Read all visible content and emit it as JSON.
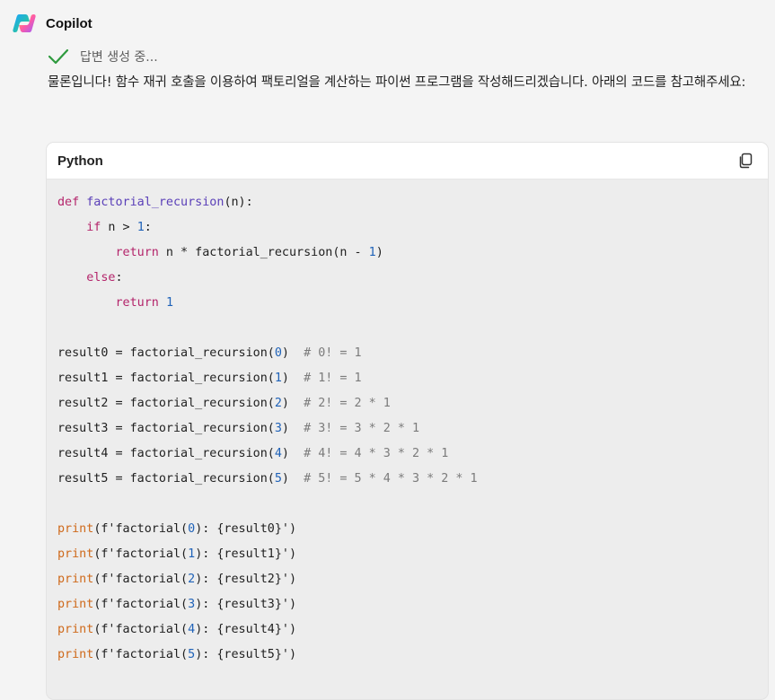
{
  "app": {
    "name": "Copilot",
    "logo_icon": "copilot-logo-icon"
  },
  "status": {
    "icon": "check-icon",
    "text": "답변 생성 중..."
  },
  "answer": {
    "text": "물론입니다! 함수 재귀 호출을 이용하여 팩토리얼을 계산하는 파이썬 프로그램을 작성해드리겠습니다. 아래의 코드를 참고해주세요:"
  },
  "code_block": {
    "language": "Python",
    "copy_icon": "copy-icon",
    "lines": [
      "def factorial_recursion(n):",
      "    if n > 1:",
      "        return n * factorial_recursion(n - 1)",
      "    else:",
      "        return 1",
      "",
      "result0 = factorial_recursion(0)  # 0! = 1",
      "result1 = factorial_recursion(1)  # 1! = 1",
      "result2 = factorial_recursion(2)  # 2! = 2 * 1",
      "result3 = factorial_recursion(3)  # 3! = 3 * 2 * 1",
      "result4 = factorial_recursion(4)  # 4! = 4 * 3 * 2 * 1",
      "result5 = factorial_recursion(5)  # 5! = 5 * 4 * 3 * 2 * 1",
      "",
      "print(f'factorial(0): {result0}')",
      "print(f'factorial(1): {result1}')",
      "print(f'factorial(2): {result2}')",
      "print(f'factorial(3): {result3}')",
      "print(f'factorial(4): {result4}')",
      "print(f'factorial(5): {result5}')"
    ]
  },
  "colors": {
    "background": "#f4f4f4",
    "keyword": "#b4256b",
    "function_name": "#5a3fb8",
    "number": "#1f62b8",
    "builtin": "#cf6a1c",
    "comment": "#7b7b7b",
    "check": "#2e9a3e"
  }
}
